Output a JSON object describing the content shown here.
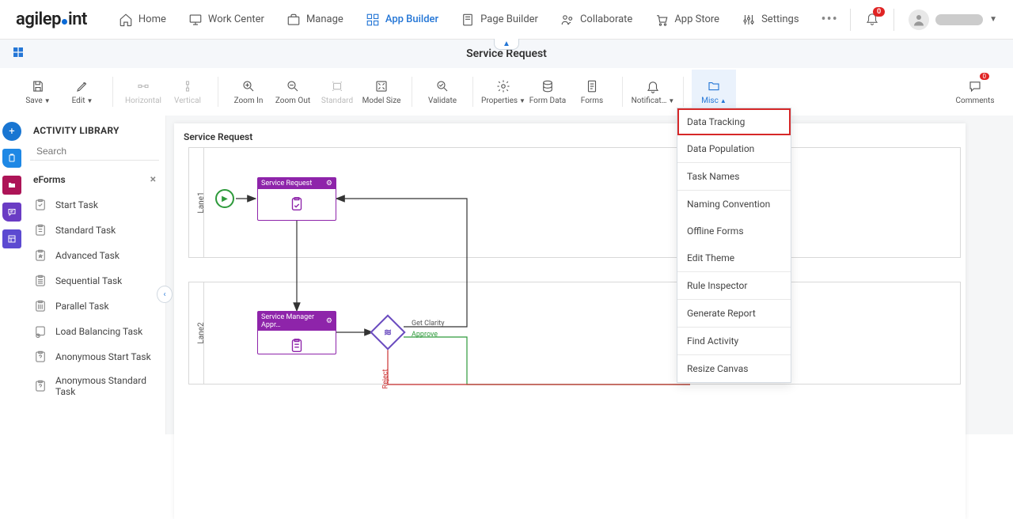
{
  "brand": "agilepoint",
  "nav": [
    {
      "label": "Home",
      "icon": "home"
    },
    {
      "label": "Work Center",
      "icon": "monitor"
    },
    {
      "label": "Manage",
      "icon": "briefcase"
    },
    {
      "label": "App Builder",
      "icon": "apps",
      "active": true
    },
    {
      "label": "Page Builder",
      "icon": "page"
    },
    {
      "label": "Collaborate",
      "icon": "people"
    },
    {
      "label": "App Store",
      "icon": "cart"
    },
    {
      "label": "Settings",
      "icon": "sliders"
    }
  ],
  "notifications": {
    "count": "0"
  },
  "page_title": "Service Request",
  "toolbar": {
    "save": "Save",
    "edit": "Edit",
    "horizontal": "Horizontal",
    "vertical": "Vertical",
    "zoom_in": "Zoom In",
    "zoom_out": "Zoom Out",
    "standard": "Standard",
    "model_size": "Model Size",
    "validate": "Validate",
    "properties": "Properties",
    "form_data": "Form Data",
    "forms": "Forms",
    "notification": "Notificat…",
    "misc": "Misc",
    "comments": "Comments",
    "comments_count": "0"
  },
  "misc_menu": {
    "data_tracking": "Data Tracking",
    "data_population": "Data Population",
    "task_names": "Task Names",
    "naming_convention": "Naming Convention",
    "offline_forms": "Offline Forms",
    "edit_theme": "Edit Theme",
    "rule_inspector": "Rule Inspector",
    "generate_report": "Generate Report",
    "find_activity": "Find Activity",
    "resize_canvas": "Resize Canvas"
  },
  "library": {
    "title": "ACTIVITY LIBRARY",
    "search_placeholder": "Search",
    "category": "eForms",
    "items": [
      "Start Task",
      "Standard Task",
      "Advanced Task",
      "Sequential Task",
      "Parallel Task",
      "Load Balancing Task",
      "Anonymous Start Task",
      "Anonymous Standard Task"
    ]
  },
  "diagram": {
    "title": "Service Request",
    "lanes": [
      "Lane1",
      "Lane2"
    ],
    "nodes": {
      "task1": "Service Request",
      "task2": "Service Manager Appr…"
    },
    "edges": {
      "get_clarity": "Get Clarity",
      "approve": "Approve",
      "reject": "Reject"
    }
  }
}
